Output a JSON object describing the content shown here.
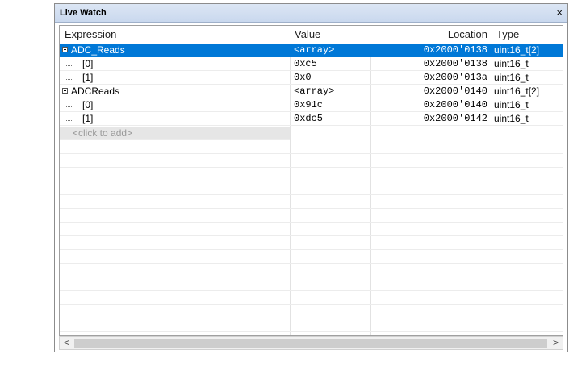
{
  "window": {
    "title": "Live Watch",
    "close_glyph": "×"
  },
  "columns": {
    "expression": "Expression",
    "value": "Value",
    "location": "Location",
    "type": "Type"
  },
  "rows": [
    {
      "expression": "ADC_Reads",
      "value": "<array>",
      "location": "0x2000'0138",
      "type": "uint16_t[2]",
      "kind": "parent",
      "selected": true
    },
    {
      "expression": "[0]",
      "value": "0xc5",
      "location": "0x2000'0138",
      "type": "uint16_t",
      "kind": "child",
      "selected": false
    },
    {
      "expression": "[1]",
      "value": "0x0",
      "location": "0x2000'013a",
      "type": "uint16_t",
      "kind": "child",
      "selected": false
    },
    {
      "expression": "ADCReads",
      "value": "<array>",
      "location": "0x2000'0140",
      "type": "uint16_t[2]",
      "kind": "parent",
      "selected": false
    },
    {
      "expression": "[0]",
      "value": "0x91c",
      "location": "0x2000'0140",
      "type": "uint16_t",
      "kind": "child",
      "selected": false
    },
    {
      "expression": "[1]",
      "value": "0xdc5",
      "location": "0x2000'0142",
      "type": "uint16_t",
      "kind": "child",
      "selected": false
    }
  ],
  "add_row": {
    "placeholder": "<click to add>"
  },
  "scrollbar": {
    "left_glyph": "<",
    "right_glyph": ">"
  }
}
